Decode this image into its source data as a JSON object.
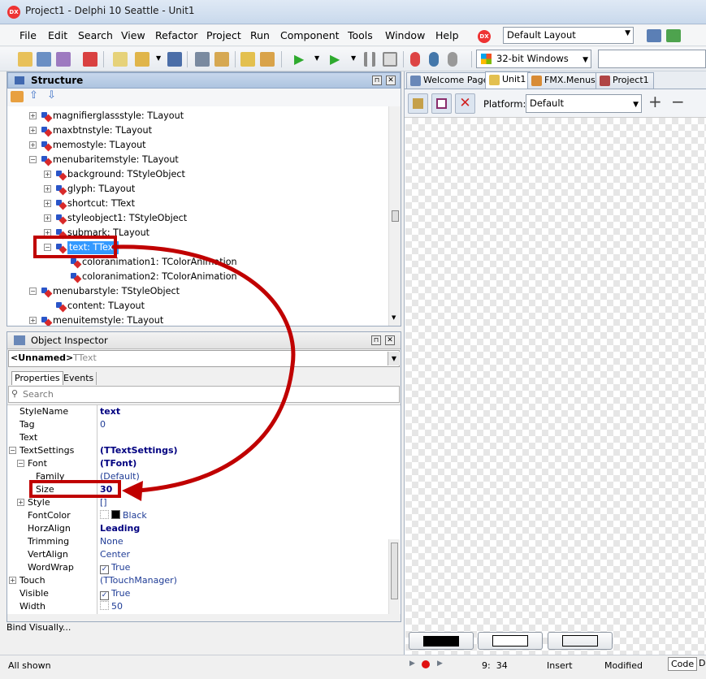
{
  "window": {
    "title": "Project1 - Delphi 10 Seattle - Unit1",
    "logo": "DX"
  },
  "menu": [
    "File",
    "Edit",
    "Search",
    "View",
    "Refactor",
    "Project",
    "Run",
    "Component",
    "Tools",
    "Window",
    "Help"
  ],
  "layout_combo": "Default Layout",
  "platform_combo": "32-bit Windows",
  "structure": {
    "title": "Structure",
    "items": [
      {
        "label": "magnifierglassstyle: TLayout",
        "level": 1,
        "exp": "+"
      },
      {
        "label": "maxbtnstyle: TLayout",
        "level": 1,
        "exp": "+"
      },
      {
        "label": "memostyle: TLayout",
        "level": 1,
        "exp": "+"
      },
      {
        "label": "menubaritemstyle: TLayout",
        "level": 1,
        "exp": "-"
      },
      {
        "label": "background: TStyleObject",
        "level": 2,
        "exp": "+"
      },
      {
        "label": "glyph: TLayout",
        "level": 2,
        "exp": "+"
      },
      {
        "label": "shortcut: TText",
        "level": 2,
        "exp": "+"
      },
      {
        "label": "styleobject1: TStyleObject",
        "level": 2,
        "exp": "+"
      },
      {
        "label": "submark: TLayout",
        "level": 2,
        "exp": "+"
      },
      {
        "label": "text: TText",
        "level": 2,
        "exp": "-",
        "selected": true
      },
      {
        "label": "coloranimation1: TColorAnimation",
        "level": 3,
        "exp": ""
      },
      {
        "label": "coloranimation2: TColorAnimation",
        "level": 3,
        "exp": ""
      },
      {
        "label": "menubarstyle: TStyleObject",
        "level": 1,
        "exp": "-"
      },
      {
        "label": "content: TLayout",
        "level": 2,
        "exp": ""
      },
      {
        "label": "menuitemstyle: TLayout",
        "level": 1,
        "exp": "+"
      }
    ]
  },
  "inspector": {
    "title": "Object Inspector",
    "object_name": "<Unnamed>",
    "object_type": "TText",
    "tabs": [
      "Properties",
      "Events"
    ],
    "search_placeholder": "Search",
    "properties": [
      {
        "name": "StyleName",
        "value": "text",
        "style": "b",
        "indent": 0,
        "exp": ""
      },
      {
        "name": "Tag",
        "value": "0",
        "style": "n",
        "indent": 0,
        "exp": ""
      },
      {
        "name": "Text",
        "value": "",
        "style": "",
        "indent": 0,
        "exp": ""
      },
      {
        "name": "TextSettings",
        "value": "(TTextSettings)",
        "style": "b",
        "indent": 0,
        "exp": "-"
      },
      {
        "name": "Font",
        "value": "(TFont)",
        "style": "b",
        "indent": 1,
        "exp": "-"
      },
      {
        "name": "Family",
        "value": "(Default)",
        "style": "n",
        "indent": 2,
        "exp": ""
      },
      {
        "name": "Size",
        "value": "30",
        "style": "b",
        "indent": 2,
        "exp": ""
      },
      {
        "name": "Style",
        "value": "[]",
        "style": "n",
        "indent": 1,
        "exp": "+"
      },
      {
        "name": "FontColor",
        "value": "Black",
        "style": "n",
        "indent": 1,
        "exp": "",
        "swatch": "#000000"
      },
      {
        "name": "HorzAlign",
        "value": "Leading",
        "style": "b",
        "indent": 1,
        "exp": ""
      },
      {
        "name": "Trimming",
        "value": "None",
        "style": "n",
        "indent": 1,
        "exp": ""
      },
      {
        "name": "VertAlign",
        "value": "Center",
        "style": "n",
        "indent": 1,
        "exp": ""
      },
      {
        "name": "WordWrap",
        "value": "True",
        "style": "n",
        "indent": 1,
        "exp": "",
        "check": true
      },
      {
        "name": "Touch",
        "value": "(TTouchManager)",
        "style": "n",
        "indent": 0,
        "exp": "+"
      },
      {
        "name": "Visible",
        "value": "True",
        "style": "n",
        "indent": 0,
        "exp": "",
        "check": true
      },
      {
        "name": "Width",
        "value": "50",
        "style": "n",
        "indent": 0,
        "exp": "",
        "lock": true
      }
    ],
    "bind_visually": "Bind Visually..."
  },
  "designer": {
    "tabs": [
      "Welcome Page",
      "Unit1",
      "FMX.Menus",
      "Project1"
    ],
    "platform_label": "Platform:",
    "platform_value": "Default"
  },
  "status": {
    "left": "All shown",
    "position": "9:  34",
    "mode": "Insert",
    "state": "Modified",
    "tabs": [
      "Code",
      "D"
    ]
  },
  "colors": {
    "accent": "#3399ff",
    "callout": "#c00000"
  }
}
